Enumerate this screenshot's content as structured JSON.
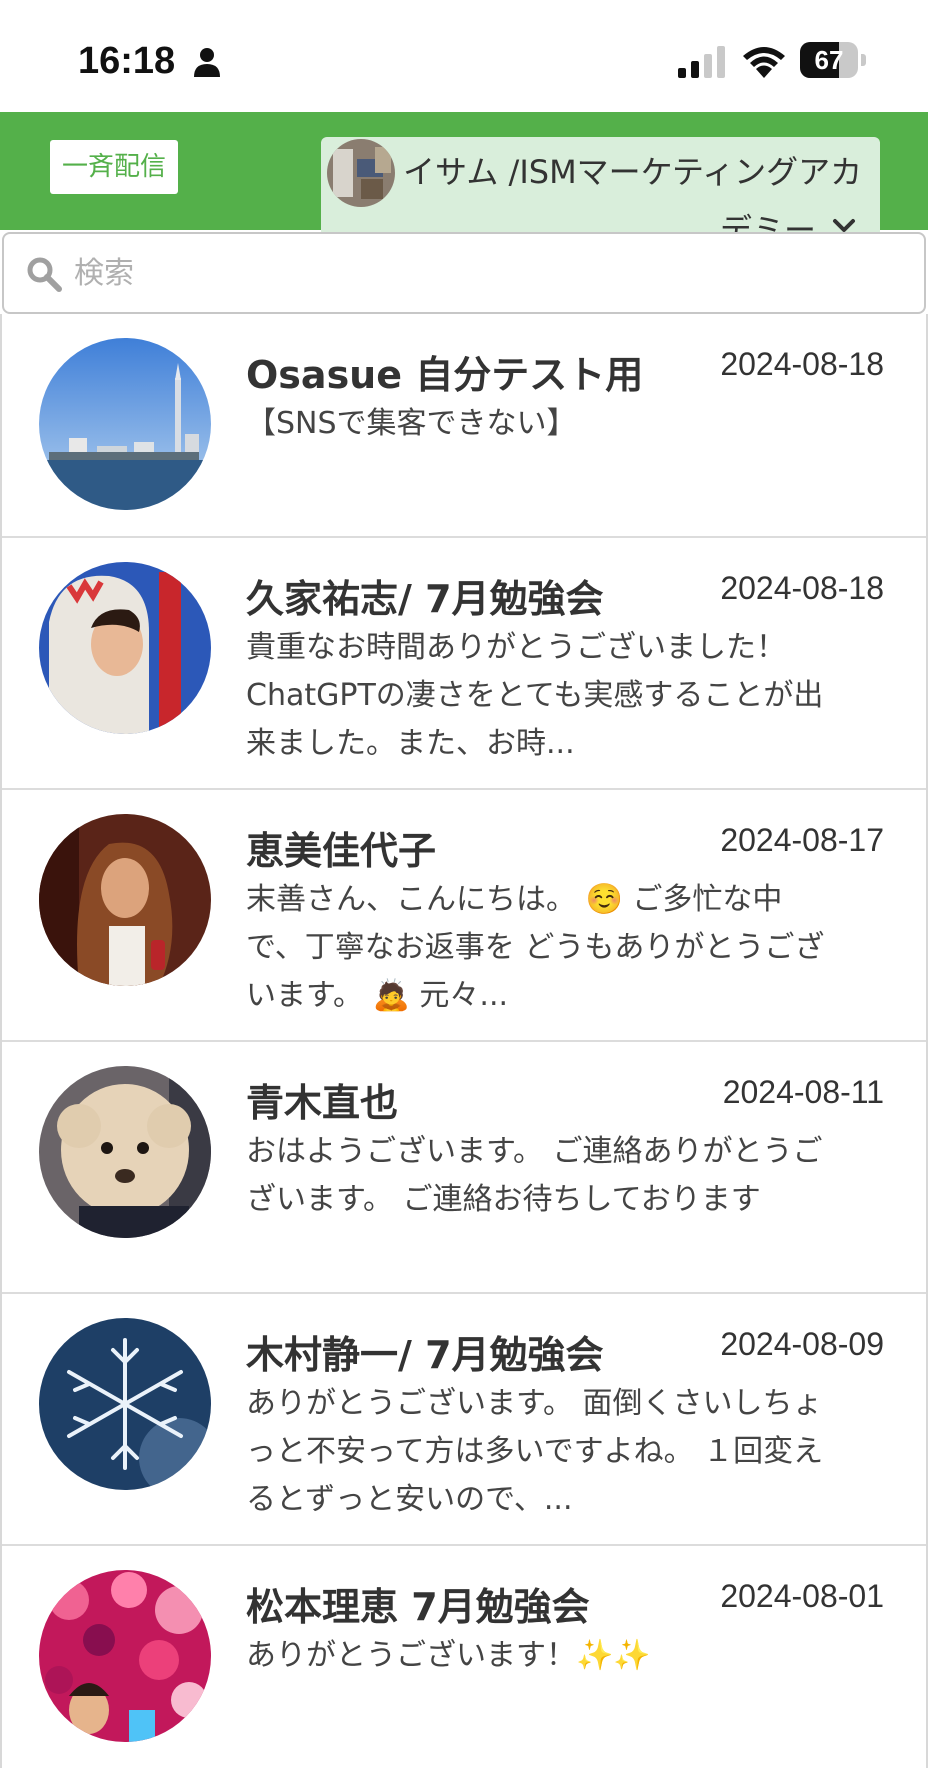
{
  "status_bar": {
    "time": "16:18",
    "battery_level": 67,
    "battery_label": "67",
    "icons": [
      "person-icon",
      "signal-icon",
      "wifi-icon",
      "battery-icon"
    ]
  },
  "header": {
    "broadcast_label": "一斉配信",
    "account_name_line1": "イサム /ISMマーケティングアカ",
    "account_name_line2": "デミー",
    "background_color": "#54b04a"
  },
  "search": {
    "placeholder": "検索",
    "value": ""
  },
  "conversations": [
    {
      "name": "Osasue 自分テスト用",
      "date": "2024-08-18",
      "message": "【SNSで集客できない】",
      "avatar_icon": "city-skyline-avatar"
    },
    {
      "name": "久家祐志/ 7月勉強会",
      "date": "2024-08-18",
      "message": "貴重なお時間ありがとうございました！ChatGPTの凄さをとても実感することが出来ました。また、お時...",
      "avatar_icon": "person-in-costume-avatar"
    },
    {
      "name": "恵美佳代子",
      "date": "2024-08-17",
      "message": "末善さん、こんにちは。 ☺️ ご多忙な中で、丁寧なお返事を どうもありがとうございます。 🙇 元々...",
      "avatar_icon": "woman-portrait-avatar"
    },
    {
      "name": "青木直也",
      "date": "2024-08-11",
      "message": "おはようございます。 ご連絡ありがとうございます。 ご連絡お待ちしております",
      "avatar_icon": "poodle-dog-avatar"
    },
    {
      "name": "木村静一/ 7月勉強会",
      "date": "2024-08-09",
      "message": "ありがとうございます。 面倒くさいしちょっと不安って方は多いですよね。 １回変えるとずっと安いので、...",
      "avatar_icon": "snowflake-avatar"
    },
    {
      "name": "松本理恵 7月勉強会",
      "date": "2024-08-01",
      "message": "ありがとうございます！✨✨",
      "avatar_icon": "flower-blossom-avatar"
    }
  ]
}
